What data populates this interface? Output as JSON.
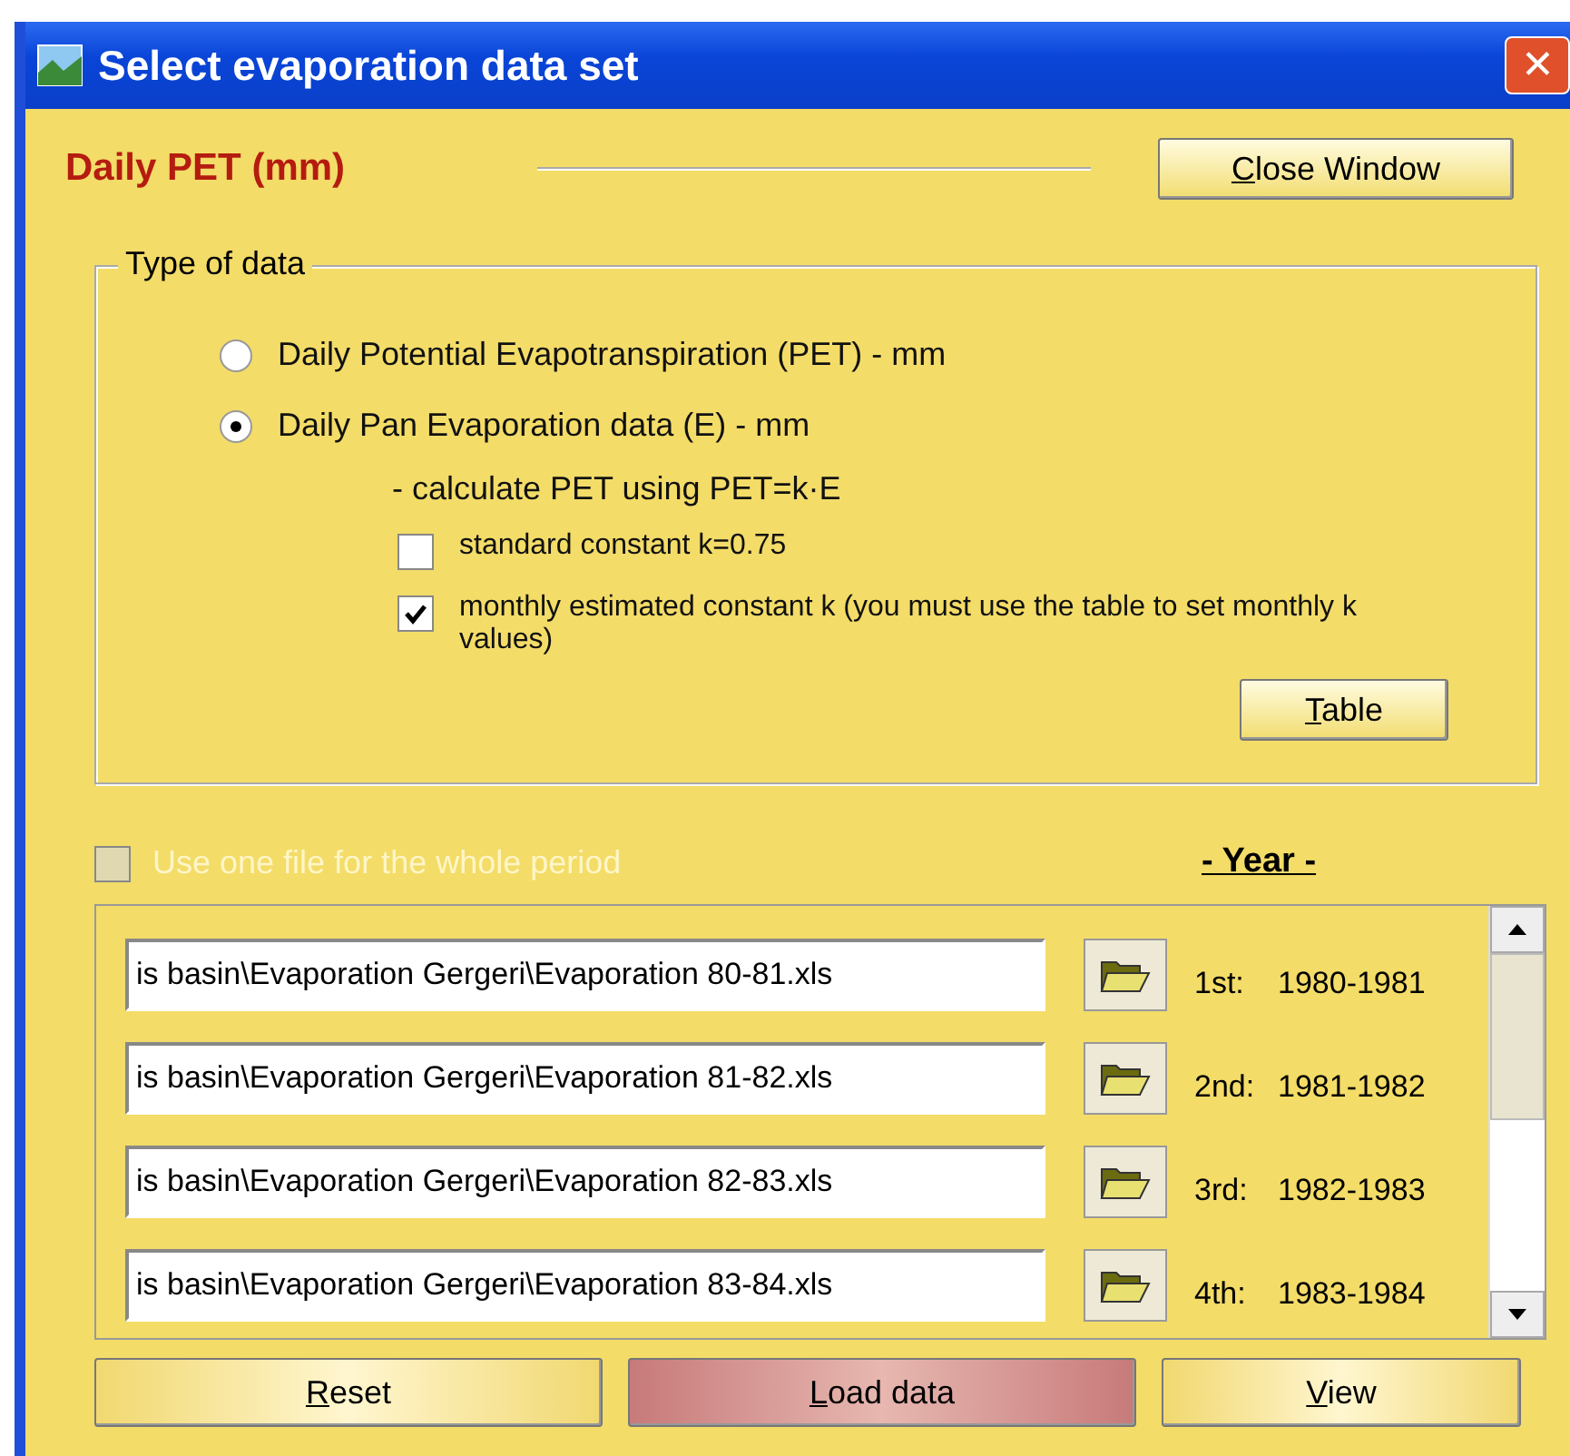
{
  "window": {
    "title": "Select evaporation data set",
    "close_symbol": "✕"
  },
  "heading": "Daily PET (mm)",
  "close_window_button": "Close Window",
  "type_of_data": {
    "title": "Type of data",
    "radios": [
      {
        "label": "Daily Potential Evapotranspiration (PET) - mm",
        "selected": false
      },
      {
        "label": "Daily Pan Evaporation data (E) - mm",
        "selected": true
      }
    ],
    "formula_note": "- calculate PET using PET=k·E",
    "checkboxes": [
      {
        "label": "standard constant k=0.75",
        "checked": false
      },
      {
        "label": "monthly estimated constant k (you must use the table to set monthly k values)",
        "checked": true
      }
    ],
    "table_button": "Table"
  },
  "one_file": {
    "label": "Use one file for the whole period",
    "checked": false,
    "disabled": true
  },
  "year_heading": "- Year -",
  "files": [
    {
      "path": "is basin\\Evaporation Gergeri\\Evaporation 80-81.xls",
      "ordinal": "1st:",
      "years": "1980-1981"
    },
    {
      "path": "is basin\\Evaporation Gergeri\\Evaporation 81-82.xls",
      "ordinal": "2nd:",
      "years": "1981-1982"
    },
    {
      "path": "is basin\\Evaporation Gergeri\\Evaporation 82-83.xls",
      "ordinal": "3rd:",
      "years": "1982-1983"
    },
    {
      "path": "is basin\\Evaporation Gergeri\\Evaporation 83-84.xls",
      "ordinal": "4th:",
      "years": "1983-1984"
    }
  ],
  "buttons": [
    {
      "label": "Reset",
      "kind": "plain"
    },
    {
      "label": "Load data",
      "kind": "primary"
    },
    {
      "label": "View",
      "kind": "plain"
    }
  ]
}
